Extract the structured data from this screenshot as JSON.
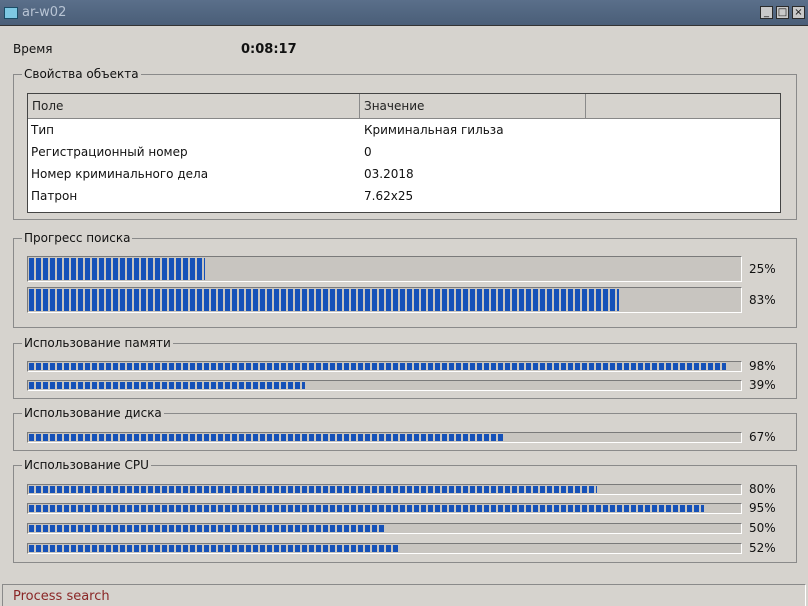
{
  "window": {
    "title": "ar-w02",
    "buttons": [
      "min-icon",
      "max-icon",
      "close-icon"
    ]
  },
  "time": {
    "label": "Время",
    "value": "0:08:17"
  },
  "properties": {
    "legend": "Свойства объекта",
    "columns": [
      "Поле",
      "Значение",
      ""
    ],
    "rows": [
      {
        "field": "Тип",
        "value": "Криминальная гильза"
      },
      {
        "field": "Регистрационный номер",
        "value": "0"
      },
      {
        "field": "Номер криминального дела",
        "value": "03.2018"
      },
      {
        "field": "Патрон",
        "value": "7.62x25"
      }
    ]
  },
  "search_progress": {
    "legend": "Прогресс поиска",
    "bars": [
      {
        "percent": 25,
        "label": "25%"
      },
      {
        "percent": 83,
        "label": "83%"
      }
    ]
  },
  "memory": {
    "legend": "Использование памяти",
    "bars": [
      {
        "percent": 98,
        "label": "98%"
      },
      {
        "percent": 39,
        "label": "39%"
      }
    ]
  },
  "disk": {
    "legend": "Использование диска",
    "bars": [
      {
        "percent": 67,
        "label": "67%"
      }
    ]
  },
  "cpu": {
    "legend": "Использование CPU",
    "bars": [
      {
        "percent": 80,
        "label": "80%"
      },
      {
        "percent": 95,
        "label": "95%"
      },
      {
        "percent": 50,
        "label": "50%"
      },
      {
        "percent": 52,
        "label": "52%"
      }
    ]
  },
  "status": {
    "text": "Process search"
  },
  "colors": {
    "bar_fill": "#1551b8",
    "status_text": "#8a2626"
  }
}
